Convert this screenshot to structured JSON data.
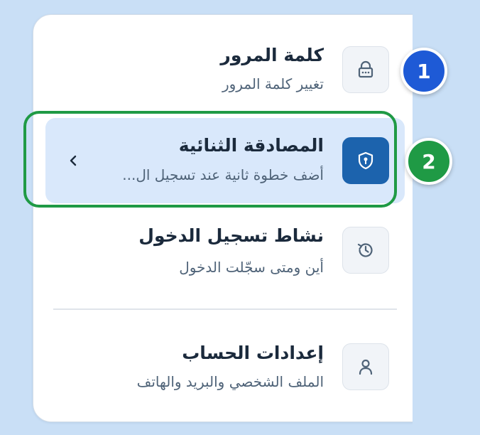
{
  "menu": {
    "items": [
      {
        "title": "كلمة المرور",
        "subtitle": "تغيير كلمة المرور",
        "icon": "lock-icon"
      },
      {
        "title": "المصادقة الثنائية",
        "subtitle": "أضف خطوة ثانية عند تسجيل ال...",
        "icon": "shield-keyhole-icon",
        "selected": true
      },
      {
        "title": "نشاط تسجيل الدخول",
        "subtitle": "أين ومتى سجّلت الدخول",
        "icon": "history-icon"
      },
      {
        "title": "إعدادات الحساب",
        "subtitle": "الملف الشخصي والبريد والهاتف",
        "icon": "user-icon"
      }
    ]
  },
  "badges": {
    "first": "1",
    "second": "2"
  },
  "colors": {
    "accent": "#1c63ad",
    "highlight": "#1f9a45",
    "badge_blue": "#1e5ad6",
    "selected_bg": "#d9e8fb"
  }
}
